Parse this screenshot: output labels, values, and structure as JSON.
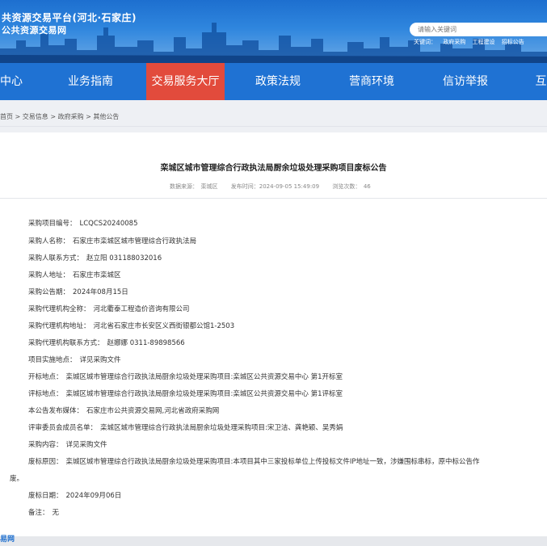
{
  "header": {
    "title_line1": "共资源交易平台(河北·石家庄)",
    "title_line2": "公共资源交易网",
    "search_placeholder": "请输入关键词",
    "hot_links": [
      "关键词：",
      "政府采购",
      "工程建设",
      "招标公告"
    ]
  },
  "nav": {
    "items": [
      {
        "label": "中心"
      },
      {
        "label": "业务指南"
      },
      {
        "label": "交易服务大厅"
      },
      {
        "label": "政策法规"
      },
      {
        "label": "营商环境"
      },
      {
        "label": "信访举报"
      },
      {
        "label": "互"
      }
    ],
    "active_index": 2
  },
  "breadcrumb": "首页 > 交易信息 > 政府采购 > 其他公告",
  "article": {
    "title": "栾城区城市管理综合行政执法局厨余垃圾处理采购项目废标公告",
    "meta": {
      "source": "数据来源：　栾城区",
      "published": "发布时间：2024-09-05 15:49:09",
      "views": "浏览次数：　46"
    },
    "fields": [
      {
        "label": "采购项目编号：",
        "value": "LCQCS20240085"
      },
      {
        "label": "采购人名称：",
        "value": "石家庄市栾城区城市管理综合行政执法局"
      },
      {
        "label": "采购人联系方式：",
        "value": "赵立阳 031188032016"
      },
      {
        "label": "采购人地址：",
        "value": "石家庄市栾城区"
      },
      {
        "label": "采购公告期：",
        "value": "2024年08月15日"
      },
      {
        "label": "采购代理机构全称：",
        "value": "河北衢泰工程造价咨询有限公司"
      },
      {
        "label": "采购代理机构地址：",
        "value": "河北省石家庄市长安区义西街银都公馆1-2503"
      },
      {
        "label": "采购代理机构联系方式：",
        "value": "赵娜娜 0311-89898566"
      },
      {
        "label": "项目实施地点：",
        "value": "详见采购文件"
      },
      {
        "label": "开标地点：",
        "value": "栾城区城市管理综合行政执法局厨余垃圾处理采购项目:栾城区公共资源交易中心 第1开标室"
      },
      {
        "label": "评标地点：",
        "value": "栾城区城市管理综合行政执法局厨余垃圾处理采购项目:栾城区公共资源交易中心 第1评标室"
      },
      {
        "label": "本公告发布媒体：",
        "value": "石家庄市公共资源交易网,河北省政府采购网"
      },
      {
        "label": "评审委员会成员名单：",
        "value": "栾城区城市管理综合行政执法局厨余垃圾处理采购项目:宋卫洁、龚艳颖、吴秀娟"
      },
      {
        "label": "采购内容：",
        "value": "详见采购文件"
      },
      {
        "label": "废标原因：",
        "value": "栾城区城市管理综合行政执法局厨余垃圾处理采购项目:本项目其中三家投标单位上传投标文件IP地址一致，涉嫌围标串标，原中标公告作"
      },
      {
        "label": "废标日期：",
        "value": "2024年09月06日"
      },
      {
        "label": "备注：",
        "value": "无"
      }
    ],
    "wrap_text": "废。"
  },
  "footer": {
    "fragment": "易网"
  },
  "colors": {
    "nav_bg": "#1f72d3",
    "nav_active": "#e24b3c",
    "banner_top": "#1d6fcf"
  }
}
